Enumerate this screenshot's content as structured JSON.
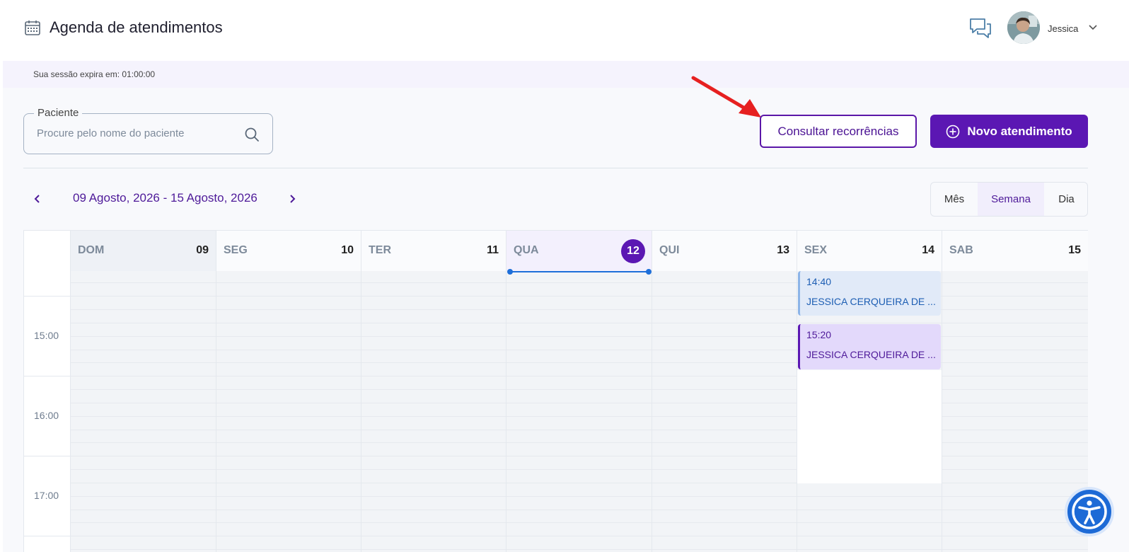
{
  "header": {
    "title": "Agenda de atendimentos",
    "user_name": "Jessica"
  },
  "session": {
    "text": "Sua sessão expira em: 01:00:00"
  },
  "toolbar": {
    "search_legend": "Paciente",
    "search_placeholder": "Procure pelo nome do paciente",
    "recurrence_label": "Consultar recorrências",
    "new_label": "Novo atendimento"
  },
  "calendar": {
    "range": "09 Agosto, 2026 - 15 Agosto, 2026",
    "views": [
      "Mês",
      "Semana",
      "Dia"
    ],
    "active_view": "Semana",
    "days": [
      {
        "name": "DOM",
        "num": "09"
      },
      {
        "name": "SEG",
        "num": "10"
      },
      {
        "name": "TER",
        "num": "11"
      },
      {
        "name": "QUA",
        "num": "12",
        "today": true
      },
      {
        "name": "QUI",
        "num": "13"
      },
      {
        "name": "SEX",
        "num": "14"
      },
      {
        "name": "SAB",
        "num": "15"
      }
    ],
    "hours": [
      "15:00",
      "16:00",
      "17:00"
    ],
    "events": [
      {
        "time": "14:40",
        "name": "JESSICA CERQUEIRA DE ...",
        "color": "blue"
      },
      {
        "time": "15:20",
        "name": "JESSICA CERQUEIRA DE ...",
        "color": "purple"
      }
    ]
  },
  "colors": {
    "primary": "#5b17b3",
    "accent_blue": "#1d6ad6",
    "annotation_arrow": "#e62020"
  }
}
